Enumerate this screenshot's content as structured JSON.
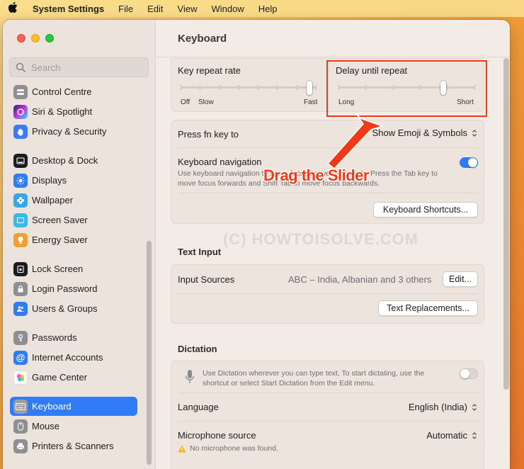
{
  "menubar": {
    "app_name": "System Settings",
    "items": [
      "File",
      "Edit",
      "View",
      "Window",
      "Help"
    ]
  },
  "sidebar": {
    "search_placeholder": "Search",
    "items": [
      {
        "label": "Control Centre",
        "icon": "control-centre-icon",
        "color": "#8e8e93"
      },
      {
        "label": "Siri & Spotlight",
        "icon": "siri-icon",
        "color": "#6b3fd8"
      },
      {
        "label": "Privacy & Security",
        "icon": "hand-icon",
        "color": "#3a7bf6"
      },
      {
        "label": "Desktop & Dock",
        "icon": "dock-icon",
        "color": "#1c1c1e"
      },
      {
        "label": "Displays",
        "icon": "sun-icon",
        "color": "#2f7cf6"
      },
      {
        "label": "Wallpaper",
        "icon": "flower-icon",
        "color": "#39a6e8"
      },
      {
        "label": "Screen Saver",
        "icon": "screensaver-icon",
        "color": "#3ab8e8"
      },
      {
        "label": "Energy Saver",
        "icon": "bulb-icon",
        "color": "#f2a22b"
      },
      {
        "label": "Lock Screen",
        "icon": "lock-screen-icon",
        "color": "#1c1c1e"
      },
      {
        "label": "Login Password",
        "icon": "lock-icon",
        "color": "#8e8e93"
      },
      {
        "label": "Users & Groups",
        "icon": "users-icon",
        "color": "#2f7cf6"
      },
      {
        "label": "Passwords",
        "icon": "key-icon",
        "color": "#8e8e93"
      },
      {
        "label": "Internet Accounts",
        "icon": "at-icon",
        "color": "#2f7cf6"
      },
      {
        "label": "Game Center",
        "icon": "game-center-icon",
        "color": "#ffffff"
      },
      {
        "label": "Keyboard",
        "icon": "keyboard-icon",
        "color": "#8e8e93",
        "selected": true
      },
      {
        "label": "Mouse",
        "icon": "mouse-icon",
        "color": "#8e8e93"
      },
      {
        "label": "Printers & Scanners",
        "icon": "printer-icon",
        "color": "#8e8e93"
      }
    ]
  },
  "main": {
    "title": "Keyboard",
    "key_repeat": {
      "label": "Key repeat rate",
      "min_label": "Off",
      "low_label": "Slow",
      "max_label": "Fast",
      "value_fraction": 0.97
    },
    "delay_repeat": {
      "label": "Delay until repeat",
      "min_label": "Long",
      "max_label": "Short",
      "value_fraction": 0.78
    },
    "fn_key": {
      "label": "Press fn key to",
      "value": "Show Emoji & Symbols"
    },
    "keyboard_nav": {
      "label": "Keyboard navigation",
      "description": "Use keyboard navigation to move focus between controls. Press the Tab key to move focus forwards and Shift Tab to move focus backwards.",
      "enabled": true
    },
    "shortcuts_button": "Keyboard Shortcuts...",
    "text_input": {
      "heading": "Text Input",
      "input_sources_label": "Input Sources",
      "input_sources_value": "ABC – India, Albanian and 3 others",
      "edit_button": "Edit...",
      "replacements_button": "Text Replacements..."
    },
    "dictation": {
      "heading": "Dictation",
      "description": "Use Dictation wherever you can type text. To start dictating, use the shortcut or select Start Dictation from the Edit menu.",
      "enabled": false,
      "language_label": "Language",
      "language_value": "English (India)",
      "mic_label": "Microphone source",
      "mic_value": "Automatic",
      "mic_warning": "No microphone was found."
    }
  },
  "annotation": {
    "text": "Drag the Slider",
    "color": "#f03a17"
  },
  "watermark": "(C) HOWTOISOLVE.COM"
}
